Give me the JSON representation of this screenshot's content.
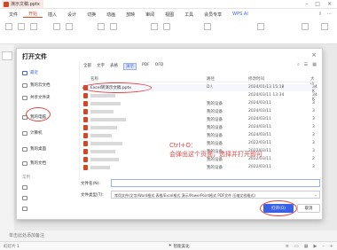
{
  "window": {
    "doc_tab": "演示文稿.pptx"
  },
  "ribbon": {
    "tabs": [
      "文件",
      "开始",
      "插入",
      "设计",
      "切换",
      "动画",
      "放映",
      "审阅",
      "视图",
      "工具",
      "会员专享"
    ],
    "active_tab": "开始",
    "ai_label": "WPS AI"
  },
  "dialog": {
    "title": "打开文件",
    "sidebar": [
      {
        "label": "最近",
        "active": true
      },
      {
        "label": "我的云文档",
        "active": false
      },
      {
        "label": "共享文件夹",
        "active": false
      },
      {
        "label": "我的电脑",
        "active": false
      },
      {
        "label": "计算机",
        "active": false
      },
      {
        "label": "我的桌面",
        "active": false
      },
      {
        "label": "我的文档",
        "active": false
      }
    ],
    "sidebar_section": "常用",
    "filters": [
      "全部",
      "文字",
      "表格",
      "演示",
      "PDF",
      "OFD"
    ],
    "active_filter": "演示",
    "columns": {
      "name": "名称",
      "path": "路径",
      "time": "修改时间",
      "size": "大小"
    },
    "files": [
      {
        "name": "Excel转演示文稿.pptx",
        "path": "D:\\",
        "time": "2024/01/13 15:18",
        "size": "34 K"
      },
      {
        "name": "",
        "path": "",
        "time": "2024/03/11 13:34",
        "size": "34 K"
      },
      {
        "name": "",
        "path": "我的设备",
        "time": "2024/03/11",
        "size": "3"
      },
      {
        "name": "",
        "path": "我的设备",
        "time": "2024/03/11",
        "size": "3"
      },
      {
        "name": "",
        "path": "我的设备",
        "time": "2024/03/11",
        "size": "3"
      },
      {
        "name": "",
        "path": "我的设备",
        "time": "2024/03/11",
        "size": "3"
      },
      {
        "name": "",
        "path": "我的设备",
        "time": "2024/03/11",
        "size": "3"
      },
      {
        "name": "",
        "path": "我的设备",
        "time": "2022/03/11",
        "size": "3"
      },
      {
        "name": "",
        "path": "我的设备",
        "time": "2022/03/11",
        "size": "3"
      },
      {
        "name": "",
        "path": "我的设备",
        "time": "2022/03/11",
        "size": "2"
      },
      {
        "name": "",
        "path": "我的设备",
        "time": "2022/03/11",
        "size": "3"
      }
    ],
    "annotation_line1": "Ctrl+O：",
    "annotation_line2": "会弹出这个页面，选择并打开即可",
    "filename_label": "文件名(N):",
    "filename_value": "",
    "filetype_label": "文件类型(T):",
    "filetype_value": "常用文件(文字/Word格式 表格/Excel格式 演示/PowerPoint格式 PDF文件 压缩文档格式)",
    "open_button": "打开(O)",
    "cancel_button": "取消"
  },
  "notes_placeholder": "单击此处添加备注",
  "status": {
    "left": "幻灯片 1",
    "smart": "智能美化"
  },
  "colors": {
    "accent_blue": "#3a62e8",
    "ppt_red": "#d24726",
    "annotation_red": "#e04444"
  }
}
